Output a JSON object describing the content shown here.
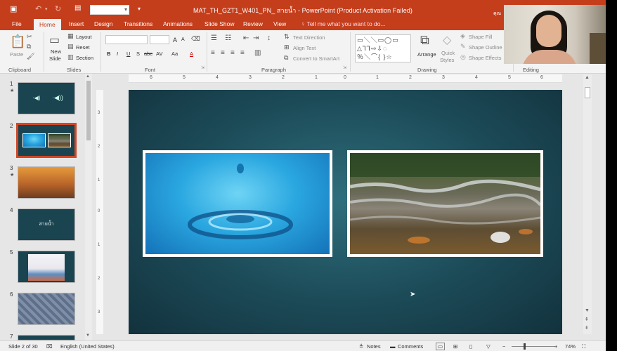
{
  "window": {
    "title": "MAT_TH_GZT1_W401_PN_ สายน้ำ - PowerPoint (Product Activation Failed)",
    "user_initials": "คุณ"
  },
  "quick_access": {
    "font_box_value": ""
  },
  "tabs": [
    "File",
    "Home",
    "Insert",
    "Design",
    "Transitions",
    "Animations",
    "Slide Show",
    "Review",
    "View"
  ],
  "tell_me": "Tell me what you want to do...",
  "ribbon": {
    "clipboard": {
      "label": "Clipboard",
      "paste": "Paste"
    },
    "slides": {
      "label": "Slides",
      "new_slide_1": "New",
      "new_slide_2": "Slide",
      "layout": "Layout",
      "reset": "Reset",
      "section": "Section"
    },
    "font": {
      "label": "Font",
      "bold": "B",
      "italic": "I",
      "underline": "U",
      "strike": "S",
      "strike2": "abc",
      "spacing": "AV",
      "grow": "A",
      "shrink": "A",
      "case": "Aa",
      "color": "A"
    },
    "paragraph": {
      "label": "Paragraph",
      "text_direction": "Text Direction",
      "align_text": "Align Text",
      "convert_smartart": "Convert to SmartArt"
    },
    "drawing": {
      "label": "Drawing",
      "arrange": "Arrange",
      "quick_styles_1": "Quick",
      "quick_styles_2": "Styles",
      "shape_fill": "Shape Fill",
      "shape_outline": "Shape Outline",
      "shape_effects": "Shape Effects"
    },
    "editing": {
      "label": "Editing"
    }
  },
  "thumbnails": [
    {
      "num": "1",
      "star": true,
      "text": "",
      "kind": "speakers"
    },
    {
      "num": "2",
      "star": false,
      "text": "",
      "kind": "photos",
      "selected": true
    },
    {
      "num": "3",
      "star": true,
      "text": "",
      "kind": "painting"
    },
    {
      "num": "4",
      "star": false,
      "text": "สายน้ำ",
      "kind": "title"
    },
    {
      "num": "5",
      "star": false,
      "text": "",
      "kind": "illustration"
    },
    {
      "num": "6",
      "star": false,
      "text": "",
      "kind": "pattern"
    },
    {
      "num": "7",
      "star": false,
      "text": "",
      "kind": "partial"
    }
  ],
  "ruler": {
    "h_labels": [
      "6",
      "5",
      "4",
      "3",
      "2",
      "1",
      "0",
      "1",
      "2",
      "3",
      "4",
      "5",
      "6"
    ],
    "v_labels": [
      "3",
      "2",
      "1",
      "0",
      "1",
      "2",
      "3"
    ]
  },
  "status": {
    "slide": "Slide 2 of 30",
    "language": "English (United States)",
    "notes": "Notes",
    "comments": "Comments",
    "zoom": "74%"
  }
}
